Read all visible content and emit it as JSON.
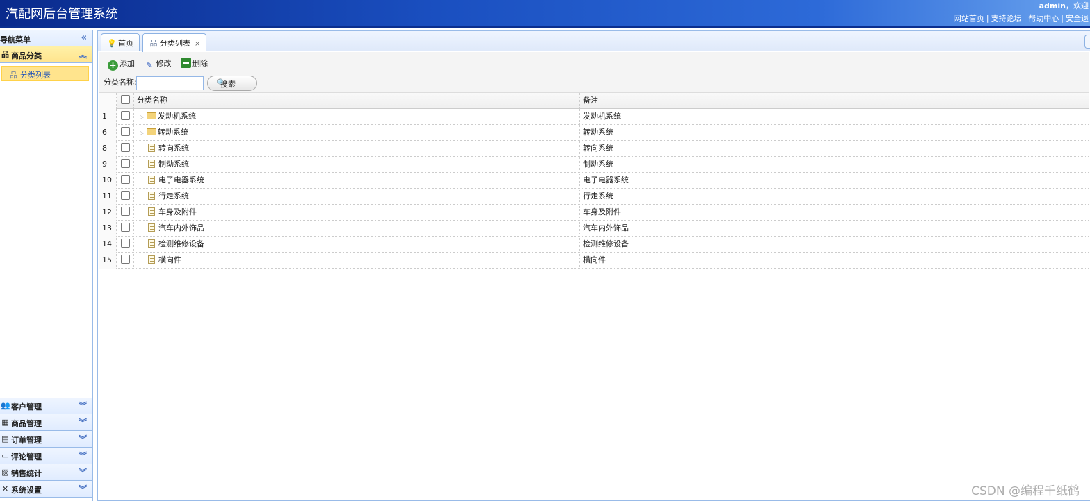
{
  "header": {
    "title": "汽配网后台管理系统",
    "user": "admin",
    "welcome": "，欢迎",
    "links": [
      "网站首页",
      "支持论坛",
      "帮助中心",
      "安全退"
    ]
  },
  "nav": {
    "title": "导航菜单",
    "active_section": "商品分类",
    "active_item": "分类列表",
    "sections": [
      "客户管理",
      "商品管理",
      "订单管理",
      "评论管理",
      "销售统计",
      "系统设置"
    ]
  },
  "tabs": [
    {
      "label": "首页"
    },
    {
      "label": "分类列表"
    }
  ],
  "toolbar": {
    "add": "添加",
    "edit": "修改",
    "delete": "删除"
  },
  "search": {
    "label": "分类名称:",
    "value": "",
    "button": "搜索"
  },
  "grid": {
    "columns": [
      "分类名称",
      "备注"
    ],
    "rows": [
      {
        "num": "1",
        "name": "发动机系统",
        "note": "发动机系统",
        "folder": true
      },
      {
        "num": "6",
        "name": "转动系统",
        "note": "转动系统",
        "folder": true
      },
      {
        "num": "8",
        "name": "转向系统",
        "note": "转向系统",
        "folder": false
      },
      {
        "num": "9",
        "name": "制动系统",
        "note": "制动系统",
        "folder": false
      },
      {
        "num": "10",
        "name": "电子电器系统",
        "note": "电子电器系统",
        "folder": false
      },
      {
        "num": "11",
        "name": "行走系统",
        "note": "行走系统",
        "folder": false
      },
      {
        "num": "12",
        "name": "车身及附件",
        "note": "车身及附件",
        "folder": false
      },
      {
        "num": "13",
        "name": "汽车内外饰品",
        "note": "汽车内外饰品",
        "folder": false
      },
      {
        "num": "14",
        "name": "检测维修设备",
        "note": "检测维修设备",
        "folder": false
      },
      {
        "num": "15",
        "name": "横向件",
        "note": "横向件",
        "folder": false
      }
    ]
  },
  "watermark": "CSDN @编程千纸鹤"
}
